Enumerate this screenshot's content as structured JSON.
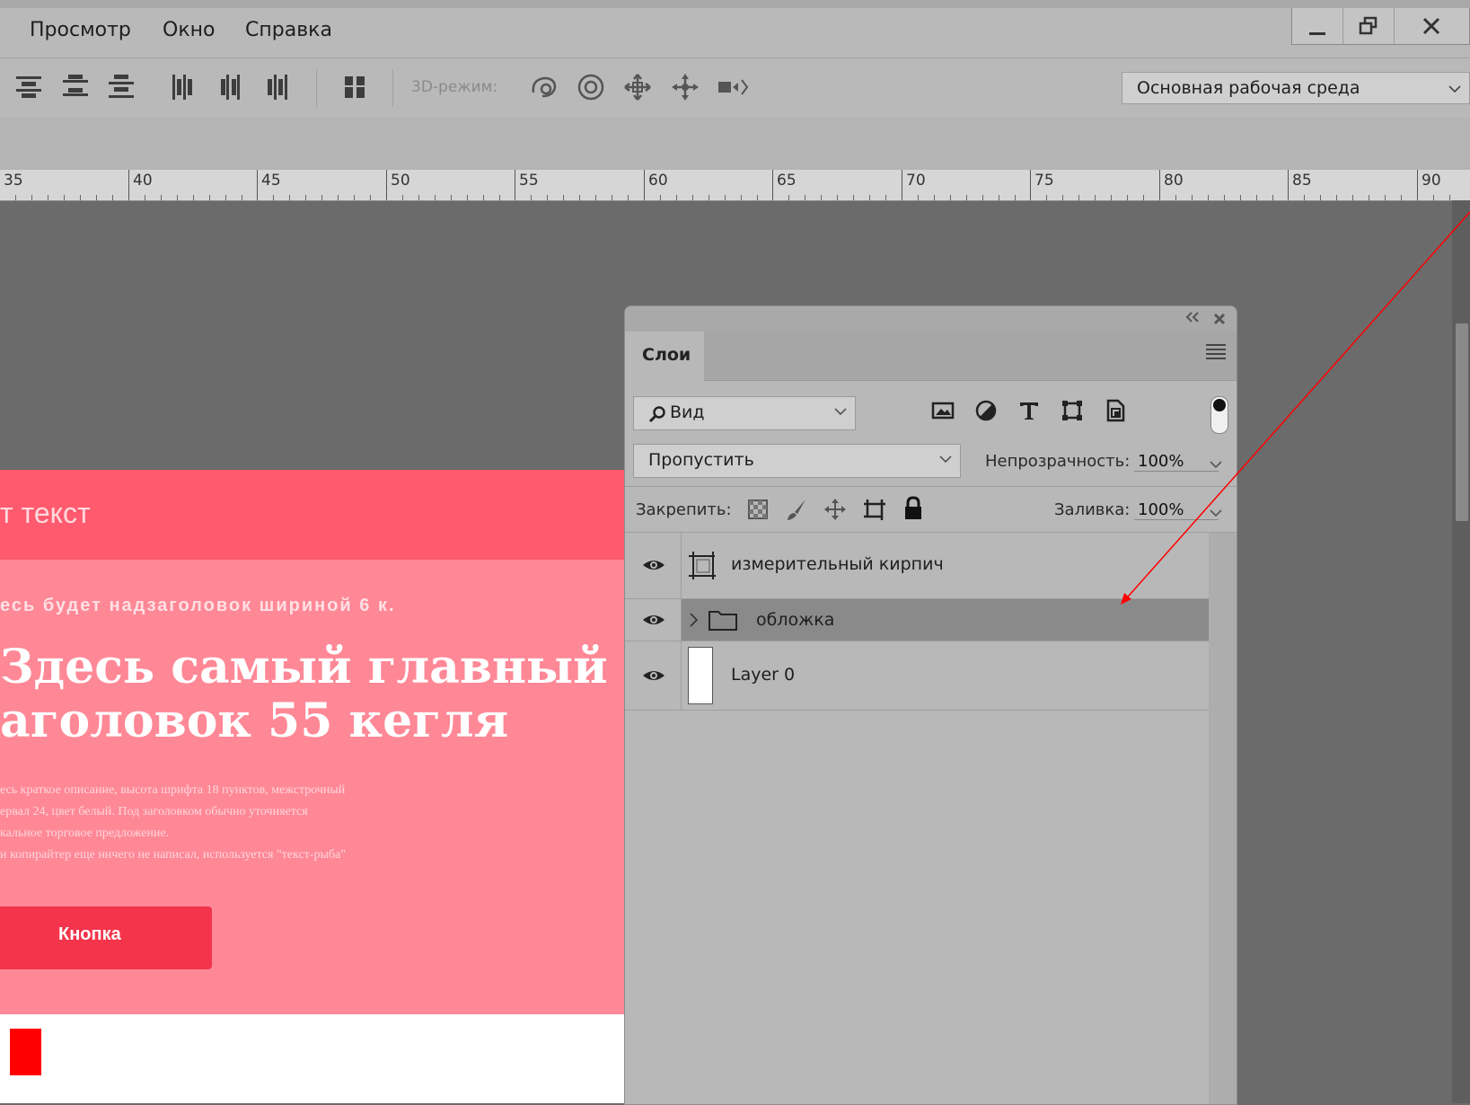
{
  "menubar": {
    "items": [
      "Просмотр",
      "Окно",
      "Справка"
    ],
    "window_controls": [
      "minimize-icon",
      "restore-icon",
      "close-icon"
    ]
  },
  "options_bar": {
    "mode_3d_label": "3D-режим:",
    "workspace": "Основная рабочая среда"
  },
  "ruler": {
    "labels": [
      "35",
      "40",
      "45",
      "50",
      "55",
      "60",
      "65",
      "70",
      "75",
      "80",
      "85",
      "90"
    ]
  },
  "document": {
    "header_text": "т текст",
    "overline": "есь будет надзаголовок шириной 6 к.",
    "title_line1": "Здесь самый главный",
    "title_line2": "аголовок 55 кегля",
    "desc_lines": [
      "есь краткое описание, высота шрифта 18 пунктов, межстрочный",
      "ервал 24, цвет белый. Под заголовком обычно уточняется",
      "кальное торговое предложение.",
      "и копирайтер еще ничего не написал, используется \"текст-рыба\""
    ],
    "button_label": "Кнопка",
    "colors": {
      "header": "#ff5a6e",
      "body": "#ff8896",
      "button": "#f4344b"
    }
  },
  "layers_panel": {
    "tab_label": "Слои",
    "filter_label": "Вид",
    "blend_mode": "Пропустить",
    "opacity_label": "Непрозрачность:",
    "opacity_value": "100%",
    "lock_label": "Закрепить:",
    "fill_label": "Заливка:",
    "fill_value": "100%",
    "layers": [
      {
        "name": "измерительный кирпич",
        "type": "artboard",
        "visible": true,
        "selected": false
      },
      {
        "name": "обложка",
        "type": "group",
        "visible": true,
        "selected": true
      },
      {
        "name": "Layer 0",
        "type": "pixel",
        "visible": true,
        "selected": false
      }
    ]
  }
}
